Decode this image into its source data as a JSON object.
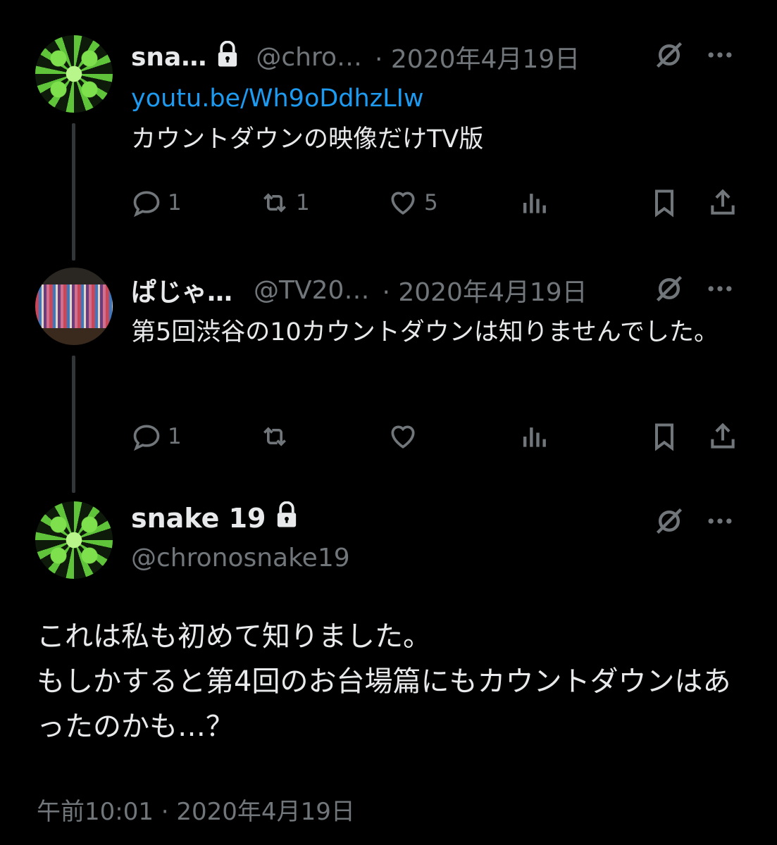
{
  "thread": [
    {
      "name": "sna…",
      "locked": true,
      "handle": "@chro…",
      "date": "· 2020年4月19日",
      "link": "youtu.be/Wh9oDdhzLIw",
      "text": "カウントダウンの映像だけTV版",
      "actions": {
        "reply": "1",
        "retweet": "1",
        "like": "5"
      }
    },
    {
      "name": "ぱじゃ…",
      "locked": false,
      "handle": "@TV20…",
      "date": "· 2020年4月19日",
      "text": "第5回渋谷の10カウントダウンは知りませんでした。",
      "actions": {
        "reply": "1",
        "retweet": "",
        "like": ""
      }
    }
  ],
  "main_tweet": {
    "name": "snake 19",
    "handle": "@chronosnake19",
    "text": "これは私も初めて知りました。\nもしかすると第4回のお台場篇にもカウントダウンはあったのかも…？",
    "timestamp": "午前10:01 · 2020年4月19日"
  },
  "icons": [
    "lock-icon",
    "grok-icon",
    "more-icon",
    "reply-icon",
    "retweet-icon",
    "like-icon",
    "views-icon",
    "bookmark-icon",
    "share-icon"
  ],
  "colors": {
    "background": "#000000",
    "text": "#e7e9ea",
    "muted": "#71767b",
    "link": "#1d9bf0",
    "thread_line": "#333639"
  }
}
